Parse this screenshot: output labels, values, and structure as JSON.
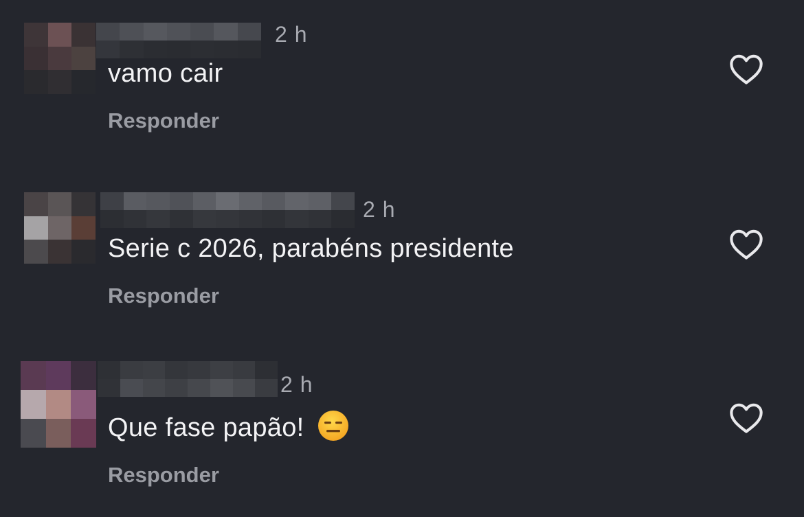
{
  "comments": [
    {
      "time": "2 h",
      "text": "vamo cair",
      "reply_label": "Responder"
    },
    {
      "time": "2 h",
      "text": "Serie c 2026, parabéns presidente",
      "reply_label": "Responder"
    },
    {
      "time": "2 h",
      "text": "Que fase papão!",
      "emoji": "expressionless-face",
      "reply_label": "Responder"
    }
  ],
  "icons": {
    "like": "heart-outline-icon"
  },
  "colors": {
    "background": "#24262d",
    "text": "#f3f3f5",
    "secondary_text": "#9a9ca3"
  }
}
